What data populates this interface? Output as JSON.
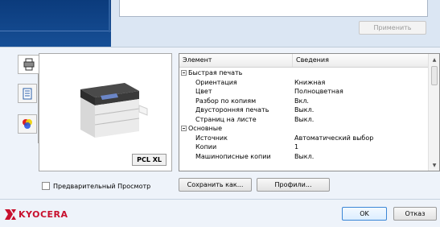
{
  "header": {
    "apply_label": "Применить"
  },
  "preview": {
    "badge": "PCL XL"
  },
  "table": {
    "headers": [
      "Элемент",
      "Сведения"
    ],
    "rows": [
      {
        "type": "group",
        "name": "Быстрая печать",
        "value": ""
      },
      {
        "type": "item",
        "name": "Ориентация",
        "value": "Книжная"
      },
      {
        "type": "item",
        "name": "Цвет",
        "value": "Полноцветная"
      },
      {
        "type": "item",
        "name": "Разбор по копиям",
        "value": "Вкл."
      },
      {
        "type": "item",
        "name": "Двусторонняя печать",
        "value": "Выкл."
      },
      {
        "type": "item",
        "name": "Страниц на листе",
        "value": "Выкл."
      },
      {
        "type": "group",
        "name": "Основные",
        "value": ""
      },
      {
        "type": "item",
        "name": "Источник",
        "value": "Автоматический выбор"
      },
      {
        "type": "item",
        "name": "Копии",
        "value": "1"
      },
      {
        "type": "item",
        "name": "Машинописные копии",
        "value": "Выкл."
      }
    ]
  },
  "controls": {
    "preview_checkbox": "Предварительный Просмотр",
    "save_as": "Сохранить как...",
    "profiles": "Профили...",
    "ok": "OK",
    "cancel": "Отказ"
  },
  "brand": {
    "logo_text": "KYOCERA",
    "accent": "#c8102e"
  },
  "icons": [
    "printer-tab-icon",
    "document-tab-icon",
    "color-tab-icon",
    "scroll-up-icon",
    "scroll-down-icon"
  ]
}
